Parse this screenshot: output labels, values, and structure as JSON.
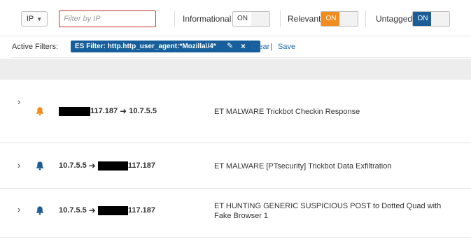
{
  "toolbar": {
    "ip_select": {
      "label": "IP",
      "chevron": "chevron-down"
    },
    "ip_filter": {
      "value": "",
      "placeholder": "Filter by IP"
    },
    "toggles": [
      {
        "label": "Informational",
        "state": "ON",
        "active": false
      },
      {
        "label": "Relevant",
        "state": "ON",
        "active": true,
        "color": "#f28c1c"
      },
      {
        "label": "Untagged",
        "state": "ON",
        "active": true,
        "color": "#1c5d97"
      }
    ]
  },
  "filters": {
    "label": "Active Filters:",
    "chip": "ES Filter: http.http_user_agent:*Mozilla\\/4*",
    "chip_edit_icon": "pencil-icon",
    "chip_remove_icon": "close-icon",
    "clear": "Clear",
    "separator": "|",
    "save": "Save"
  },
  "alerts": [
    {
      "bell_color": "#f28c1c",
      "src": "117.187",
      "src_redacted": true,
      "dst": "10.7.5.5",
      "dst_redacted": false,
      "signature": "ET MALWARE Trickbot Checkin Response"
    },
    {
      "bell_color": "#1c5d97",
      "src": "10.7.5.5",
      "src_redacted": false,
      "dst": "117.187",
      "dst_redacted": true,
      "signature": "ET MALWARE [PTsecurity] Trickbot Data Exfiltration"
    },
    {
      "bell_color": "#1c5d97",
      "src": "10.7.5.5",
      "src_redacted": false,
      "dst": "117.187",
      "dst_redacted": true,
      "signature": "ET HUNTING GENERIC SUSPICIOUS POST to Dotted Quad with Fake Browser 1"
    }
  ],
  "arrow": "➜"
}
